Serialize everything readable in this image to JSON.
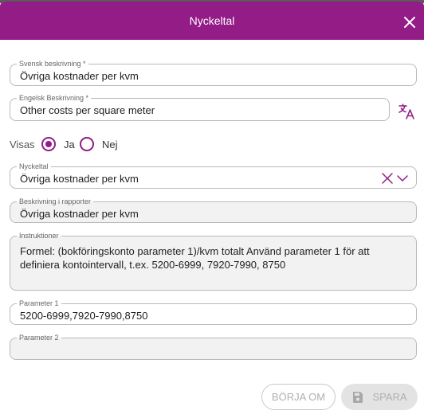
{
  "dialog": {
    "title": "Nyckeltal",
    "close_icon": "close-icon"
  },
  "form": {
    "svensk": {
      "label": "Svensk beskrivning *",
      "value": "Övriga kostnader per kvm"
    },
    "engelsk": {
      "label": "Engelsk Beskrivning *",
      "value": "Other costs per square meter"
    },
    "translate_icon": "translate-icon",
    "visas": {
      "label": "Visas",
      "options": [
        "Ja",
        "Nej"
      ],
      "selected": "Ja"
    },
    "nyckeltal": {
      "label": "Nyckeltal",
      "value": "Övriga kostnader per kvm"
    },
    "beskrivning_rapporter": {
      "label": "Beskrivning i rapporter",
      "value": "Övriga kostnader per kvm"
    },
    "instruktioner": {
      "label": "Instruktioner",
      "value": "Formel: (bokföringskonto parameter 1)/kvm totalt Använd parameter 1 för att definiera kontointervall, t.ex. 5200-6999, 7920-7990, 8750"
    },
    "parameter1": {
      "label": "Parameter 1",
      "value": "5200-6999,7920-7990,8750"
    },
    "parameter2": {
      "label": "Parameter 2",
      "value": ""
    }
  },
  "footer": {
    "reset_label": "BÖRJA OM",
    "save_label": "SPARA"
  },
  "colors": {
    "accent": "#931c86",
    "disabled_text": "#b0b0b0"
  }
}
